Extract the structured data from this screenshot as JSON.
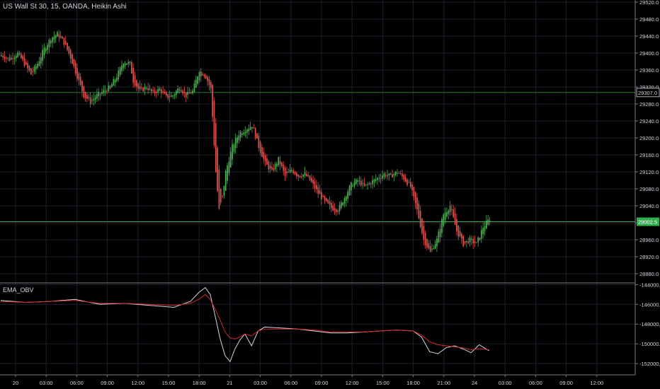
{
  "title": "US Wall St 30, 15, OANDA, Heikin Ashi",
  "indicator_title": "EMA_OBV",
  "colors": {
    "background": "#000000",
    "grid": "#1b1f2a",
    "up": "#4caf50",
    "down": "#e0524f",
    "axis_text": "#d1d4dc",
    "hline": "#1f7a2a",
    "price_badge": "#2fae4b",
    "obv_line": "#d1d4dc",
    "ema_line": "#d42b2b"
  },
  "price_axis": {
    "ticks": [
      "29520.0",
      "29480.0",
      "29440.0",
      "29400.0",
      "29360.0",
      "29320.0",
      "29280.0",
      "29240.0",
      "29200.0",
      "29160.0",
      "29120.0",
      "29080.0",
      "29040.0",
      "29000.0",
      "28960.0",
      "28920.0",
      "28880.0"
    ],
    "min": 28860,
    "max": 29525
  },
  "price_labels": {
    "h_line_level": "29307.0",
    "current_price": "29002.5"
  },
  "indicator_axis": {
    "ticks": [
      "-144000.0",
      "-146000.0",
      "-148000.0",
      "-150000.0",
      "-152000.0"
    ],
    "min": -153000,
    "max": -143900
  },
  "time_axis": {
    "labels": [
      "20",
      "03:00",
      "06:00",
      "09:00",
      "12:00",
      "15:00",
      "18:00",
      "21",
      "03:00",
      "06:00",
      "09:00",
      "12:00",
      "15:00",
      "18:00",
      "21:00",
      "24",
      "03:00",
      "06:00",
      "09:00",
      "12:00"
    ]
  },
  "chart_data": [
    {
      "type": "candlestick",
      "title": "US Wall St 30, 15, OANDA, Heikin Ashi",
      "description": "Heikin Ashi candles; levels read off the price axis (approximate path of closes)",
      "close_path": [
        [
          0,
          29395
        ],
        [
          5,
          29385
        ],
        [
          10,
          29400
        ],
        [
          14,
          29375
        ],
        [
          18,
          29350
        ],
        [
          22,
          29375
        ],
        [
          26,
          29410
        ],
        [
          30,
          29435
        ],
        [
          34,
          29445
        ],
        [
          38,
          29425
        ],
        [
          42,
          29390
        ],
        [
          46,
          29345
        ],
        [
          50,
          29300
        ],
        [
          54,
          29285
        ],
        [
          58,
          29300
        ],
        [
          62,
          29310
        ],
        [
          66,
          29320
        ],
        [
          70,
          29345
        ],
        [
          74,
          29380
        ],
        [
          78,
          29375
        ],
        [
          80,
          29335
        ],
        [
          84,
          29310
        ],
        [
          88,
          29320
        ],
        [
          92,
          29305
        ],
        [
          96,
          29315
        ],
        [
          100,
          29295
        ],
        [
          104,
          29300
        ],
        [
          108,
          29320
        ],
        [
          112,
          29300
        ],
        [
          116,
          29310
        ],
        [
          120,
          29360
        ],
        [
          124,
          29345
        ],
        [
          127,
          29315
        ],
        [
          128,
          29250
        ],
        [
          130,
          29120
        ],
        [
          132,
          29030
        ],
        [
          134,
          29060
        ],
        [
          136,
          29120
        ],
        [
          140,
          29180
        ],
        [
          144,
          29210
        ],
        [
          148,
          29220
        ],
        [
          152,
          29230
        ],
        [
          156,
          29180
        ],
        [
          160,
          29140
        ],
        [
          164,
          29120
        ],
        [
          168,
          29150
        ],
        [
          172,
          29110
        ],
        [
          176,
          29125
        ],
        [
          180,
          29110
        ],
        [
          184,
          29115
        ],
        [
          188,
          29095
        ],
        [
          192,
          29070
        ],
        [
          196,
          29050
        ],
        [
          200,
          29035
        ],
        [
          204,
          29030
        ],
        [
          208,
          29060
        ],
        [
          212,
          29090
        ],
        [
          216,
          29100
        ],
        [
          220,
          29085
        ],
        [
          224,
          29095
        ],
        [
          228,
          29105
        ],
        [
          232,
          29115
        ],
        [
          236,
          29110
        ],
        [
          240,
          29120
        ],
        [
          244,
          29105
        ],
        [
          248,
          29085
        ],
        [
          252,
          29030
        ],
        [
          256,
          28960
        ],
        [
          260,
          28930
        ],
        [
          264,
          28960
        ],
        [
          268,
          29020
        ],
        [
          272,
          29040
        ],
        [
          276,
          28980
        ],
        [
          280,
          28950
        ],
        [
          284,
          28960
        ],
        [
          288,
          28950
        ],
        [
          292,
          28990
        ],
        [
          296,
          29010
        ]
      ]
    },
    {
      "type": "line",
      "title": "EMA_OBV",
      "series": [
        {
          "name": "OBV",
          "color_key": "obv_line"
        },
        {
          "name": "EMA",
          "color_key": "ema_line"
        }
      ],
      "x": [
        0,
        15,
        30,
        45,
        60,
        75,
        90,
        105,
        115,
        120,
        124,
        127,
        130,
        133,
        136,
        139,
        142,
        145,
        148,
        152,
        156,
        160,
        170,
        180,
        190,
        200,
        210,
        220,
        230,
        240,
        250,
        255,
        260,
        265,
        270,
        275,
        280,
        285,
        290,
        296
      ],
      "obv": [
        -145600,
        -145800,
        -145700,
        -145500,
        -146000,
        -145900,
        -146100,
        -146300,
        -145700,
        -144800,
        -144300,
        -145000,
        -147200,
        -149500,
        -151200,
        -151800,
        -150500,
        -149600,
        -149000,
        -150200,
        -148700,
        -148300,
        -148400,
        -148500,
        -148700,
        -148900,
        -148900,
        -148800,
        -148700,
        -148600,
        -148700,
        -149300,
        -150800,
        -151000,
        -150400,
        -150200,
        -150500,
        -150900,
        -150100,
        -150700
      ],
      "ema": [
        -145700,
        -145800,
        -145700,
        -145600,
        -145900,
        -145900,
        -146000,
        -146100,
        -145900,
        -145500,
        -145000,
        -145500,
        -146500,
        -147600,
        -148800,
        -149400,
        -149500,
        -149300,
        -149000,
        -149200,
        -148700,
        -148500,
        -148500,
        -148500,
        -148600,
        -148800,
        -148800,
        -148800,
        -148700,
        -148600,
        -148700,
        -149100,
        -149800,
        -150100,
        -150200,
        -150300,
        -150400,
        -150600,
        -150500,
        -150600
      ]
    }
  ]
}
